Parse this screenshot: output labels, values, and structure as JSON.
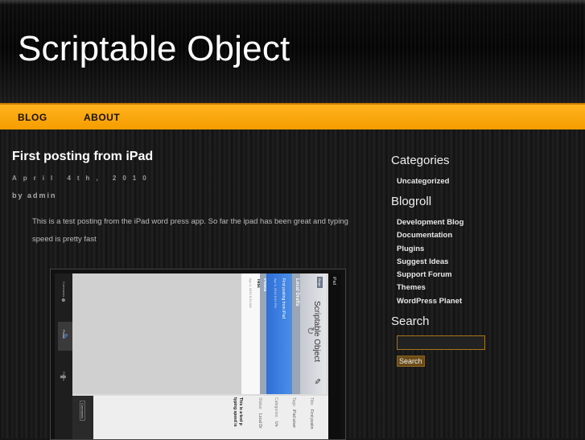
{
  "site": {
    "title": "Scriptable Object"
  },
  "nav": [
    {
      "label": "BLOG"
    },
    {
      "label": "ABOUT"
    }
  ],
  "post": {
    "title": "First posting from iPad",
    "date": "April 4th, 2010",
    "author": "by admin",
    "body": "This is a test posting from the iPad word press app. So far the ipad has been great and typing speed is pretty fast"
  },
  "sidebar": {
    "categories_heading": "Categories",
    "categories": [
      "Uncategorized"
    ],
    "blogroll_heading": "Blogroll",
    "blogroll": [
      "Development Blog",
      "Documentation",
      "Plugins",
      "Suggest Ideas",
      "Support Forum",
      "Themes",
      "WordPress Planet"
    ],
    "search_heading": "Search",
    "search_value": "",
    "search_button": "Search"
  },
  "ipad_shot": {
    "status": "iPad",
    "app_title": "Scriptable Object",
    "back": "Blogs",
    "local_drafts": "Local Drafts",
    "draft_title": "First posting from iPad",
    "draft_date": "Apr 4, 2010 8:52 PM",
    "posts_header": "Posts",
    "post_title": "Test",
    "post_date": "Apr 4, 2010 8:32 AM",
    "tab_comments": "Comments",
    "tab_posts": "Posts",
    "tab_pages": "Pages",
    "field_title": "Title:",
    "field_title_val": "First postin",
    "field_tags": "Tags:",
    "field_tags_val": "iPad wiser",
    "field_categories": "Categories:",
    "field_categories_val": "Un",
    "field_status": "Status:",
    "field_status_val": "Local Dr",
    "body_line1": "This is a test p",
    "body_line2": "typing speed is",
    "comments_btn": "Comments"
  }
}
